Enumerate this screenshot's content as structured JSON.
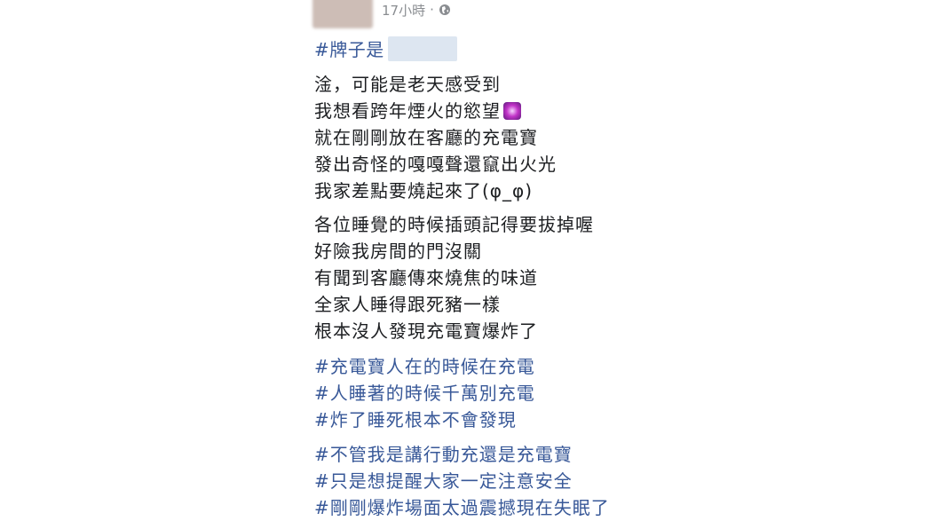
{
  "header": {
    "timestamp": "17小時",
    "separator": "·",
    "privacy_icon": "globe-icon"
  },
  "brand_tag": "#牌子是",
  "paragraph1": [
    "淦，可能是老天感受到",
    "我想看跨年煙火的慾望",
    "就在剛剛放在客廳的充電寶",
    "發出奇怪的嘎嘎聲還竄出火光",
    "我家差點要燒起來了(φ_φ)"
  ],
  "paragraph2": [
    "各位睡覺的時候插頭記得要拔掉喔",
    "好險我房間的門沒關",
    "有聞到客廳傳來燒焦的味道",
    "全家人睡得跟死豬一樣",
    "根本沒人發現充電寶爆炸了"
  ],
  "hashtags1": [
    "#充電寶人在的時候在充電",
    "#人睡著的時候千萬別充電",
    "#炸了睡死根本不會發現"
  ],
  "hashtags2": [
    "#不管我是講行動充還是充電寶",
    "#只是想提醒大家一定注意安全",
    "#剛剛爆炸場面太過震撼現在失眠了"
  ],
  "colors": {
    "text": "#1c1e21",
    "link": "#385898",
    "meta": "#8a8d91"
  }
}
